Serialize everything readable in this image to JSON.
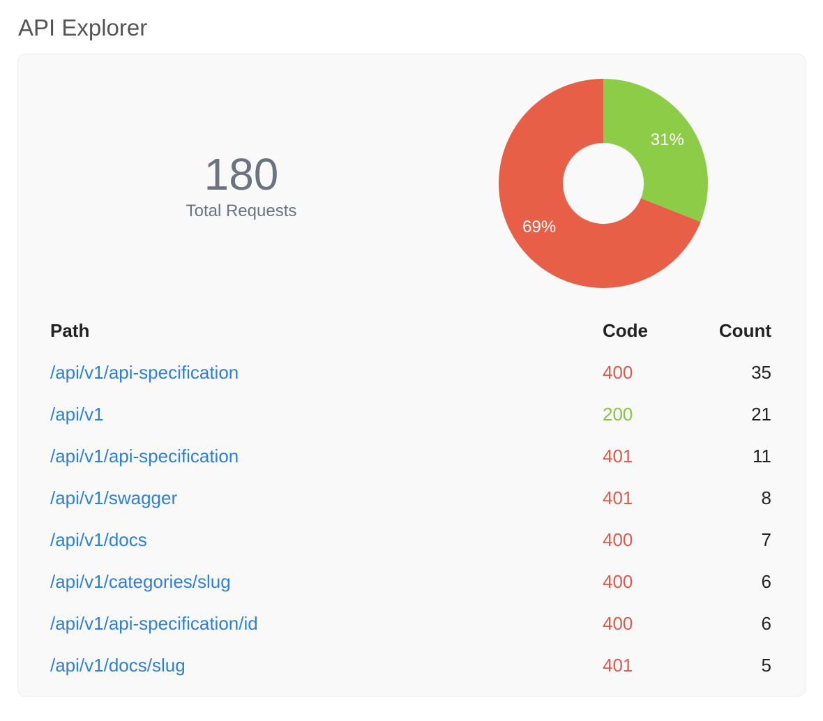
{
  "page": {
    "title": "API Explorer"
  },
  "summary": {
    "total": "180",
    "label": "Total Requests"
  },
  "chart_data": {
    "type": "pie",
    "donut": true,
    "slices": [
      {
        "label": "31%",
        "value": 31,
        "color": "#8dcc47"
      },
      {
        "label": "69%",
        "value": 69,
        "color": "#e85f48"
      }
    ]
  },
  "table": {
    "headers": {
      "path": "Path",
      "code": "Code",
      "count": "Count"
    },
    "rows": [
      {
        "path": "/api/v1/api-specification",
        "code": "400",
        "count": "35",
        "status": "error"
      },
      {
        "path": "/api/v1",
        "code": "200",
        "count": "21",
        "status": "ok"
      },
      {
        "path": "/api/v1/api-specification",
        "code": "401",
        "count": "11",
        "status": "error"
      },
      {
        "path": "/api/v1/swagger",
        "code": "401",
        "count": "8",
        "status": "error"
      },
      {
        "path": "/api/v1/docs",
        "code": "400",
        "count": "7",
        "status": "error"
      },
      {
        "path": "/api/v1/categories/slug",
        "code": "400",
        "count": "6",
        "status": "error"
      },
      {
        "path": "/api/v1/api-specification/id",
        "code": "400",
        "count": "6",
        "status": "error"
      },
      {
        "path": "/api/v1/docs/slug",
        "code": "401",
        "count": "5",
        "status": "error"
      }
    ]
  },
  "colors": {
    "link": "#2f7fd8",
    "code_error": "#e2594a",
    "code_ok": "#86c73f"
  }
}
